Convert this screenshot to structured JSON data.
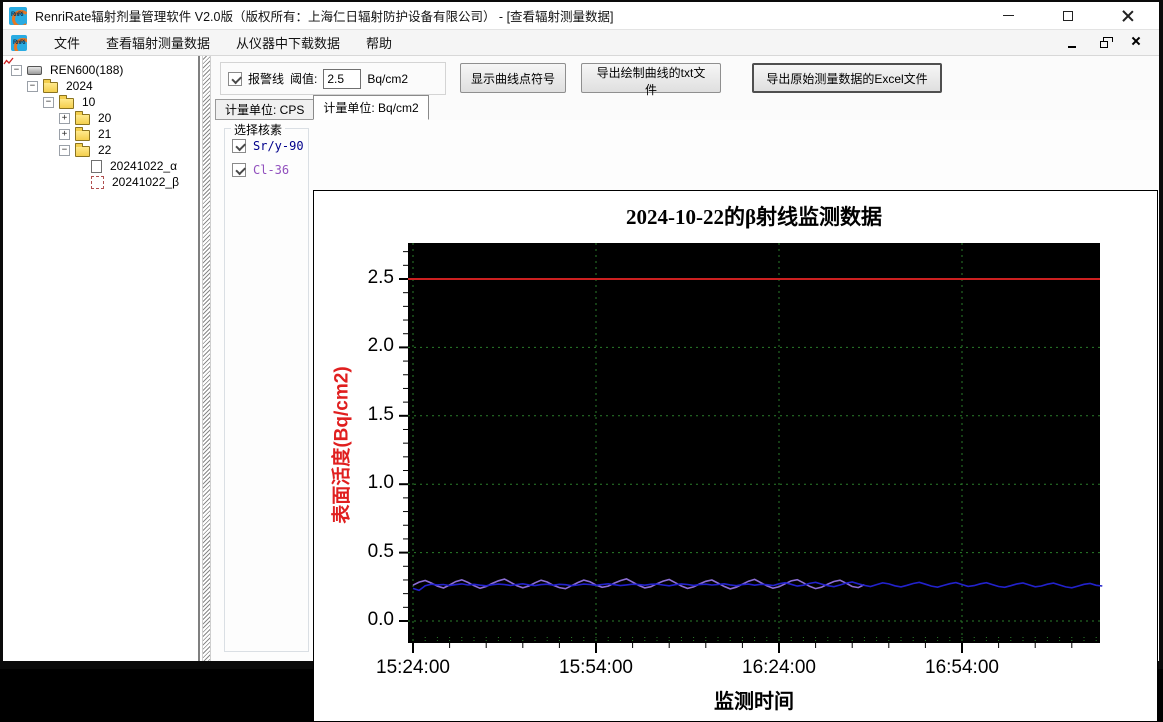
{
  "window": {
    "title": "RenriRate辐射剂量管理软件 V2.0版（版权所有：上海仁日辐射防护设备有限公司） - [查看辐射测量数据]"
  },
  "menu": {
    "items": [
      "文件",
      "查看辐射测量数据",
      "从仪器中下载数据",
      "帮助"
    ]
  },
  "tree": {
    "items": [
      {
        "label": "REN600(188)",
        "level": 0,
        "toggle": "minus",
        "icon": "device"
      },
      {
        "label": "2024",
        "level": 1,
        "toggle": "minus",
        "icon": "folder"
      },
      {
        "label": "10",
        "level": 2,
        "toggle": "minus",
        "icon": "folder"
      },
      {
        "label": "20",
        "level": 3,
        "toggle": "plus",
        "icon": "folder"
      },
      {
        "label": "21",
        "level": 3,
        "toggle": "plus",
        "icon": "folder"
      },
      {
        "label": "22",
        "level": 3,
        "toggle": "minus",
        "icon": "folder"
      },
      {
        "label": "20241022_α",
        "level": 4,
        "toggle": "none",
        "icon": "doc"
      },
      {
        "label": "20241022_β",
        "level": 4,
        "toggle": "none",
        "icon": "chart"
      }
    ]
  },
  "toolbar": {
    "alarm_label": "报警线",
    "threshold_label": "阈值:",
    "threshold_value": "2.5",
    "threshold_unit": "Bq/cm2",
    "buttons": [
      "显示曲线点符号",
      "导出绘制曲线的txt文件",
      "导出原始测量数据的Excel文件"
    ]
  },
  "tabs": [
    {
      "id": "cps",
      "label": "计量单位: CPS",
      "active": false
    },
    {
      "id": "bqcm2",
      "label": "计量单位: Bq/cm2",
      "active": true
    }
  ],
  "nuclide_panel": {
    "title": "选择核素",
    "items": [
      {
        "label": "Sr/y-90",
        "checked": true,
        "color": "#00008b"
      },
      {
        "label": "Cl-36",
        "checked": true,
        "color": "#9150be"
      }
    ]
  },
  "chart_data": {
    "type": "line",
    "title": "2024-10-22的β射线监测数据",
    "xlabel": "监测时间",
    "ylabel": "表面活度(Bq/cm2)",
    "ylabel_color": "#e01f1f",
    "plot_bg": "#000000",
    "grid_color": "#2a7d2a",
    "grid": true,
    "ylim": [
      0,
      2.5
    ],
    "yticks": [
      0.0,
      0.5,
      1.0,
      1.5,
      2.0,
      2.5
    ],
    "xticks": [
      {
        "label": "15:24:00",
        "minute": 0
      },
      {
        "label": "15:54:00",
        "minute": 30
      },
      {
        "label": "16:24:00",
        "minute": 60
      },
      {
        "label": "16:54:00",
        "minute": 90
      }
    ],
    "x_range_minutes": [
      0,
      112
    ],
    "alarm_line": {
      "value": 2.5,
      "color": "#cc2020"
    },
    "series": [
      {
        "name": "Cl-36",
        "color": "#8d6fd6",
        "start_minute": 0,
        "step_minutes": 1,
        "values": [
          0.262,
          0.284,
          0.296,
          0.278,
          0.255,
          0.241,
          0.263,
          0.288,
          0.301,
          0.282,
          0.258,
          0.239,
          0.252,
          0.275,
          0.294,
          0.306,
          0.283,
          0.259,
          0.243,
          0.256,
          0.279,
          0.298,
          0.285,
          0.261,
          0.244,
          0.236,
          0.258,
          0.281,
          0.299,
          0.287,
          0.263,
          0.246,
          0.255,
          0.277,
          0.295,
          0.308,
          0.284,
          0.26,
          0.242,
          0.251,
          0.273,
          0.292,
          0.303,
          0.28,
          0.256,
          0.238,
          0.249,
          0.271,
          0.29,
          0.3,
          0.277,
          0.253,
          0.235,
          0.247,
          0.269,
          0.291,
          0.304,
          0.281,
          0.257,
          0.24,
          0.25,
          0.272,
          0.293,
          0.302,
          0.279,
          0.254,
          0.237,
          0.248,
          0.27,
          0.289,
          0.298,
          0.276,
          0.252,
          0.244,
          0.266
        ]
      },
      {
        "name": "Sr/y-90",
        "color": "#2222cc",
        "start_minute": 0,
        "step_minutes": 1,
        "values": [
          0.238,
          0.224,
          0.258,
          0.269,
          0.264,
          0.267,
          0.259,
          0.266,
          0.271,
          0.263,
          0.268,
          0.262,
          0.257,
          0.265,
          0.27,
          0.266,
          0.26,
          0.267,
          0.272,
          0.264,
          0.259,
          0.266,
          0.269,
          0.262,
          0.268,
          0.265,
          0.258,
          0.263,
          0.27,
          0.267,
          0.261,
          0.266,
          0.272,
          0.265,
          0.259,
          0.264,
          0.269,
          0.266,
          0.262,
          0.268,
          0.27,
          0.263,
          0.257,
          0.265,
          0.271,
          0.267,
          0.26,
          0.266,
          0.269,
          0.263,
          0.267,
          0.272,
          0.264,
          0.258,
          0.266,
          0.27,
          0.262,
          0.268,
          0.265,
          0.259,
          0.272,
          0.28,
          0.268,
          0.255,
          0.262,
          0.275,
          0.283,
          0.27,
          0.258,
          0.251,
          0.263,
          0.277,
          0.285,
          0.272,
          0.26,
          0.252,
          0.266,
          0.279,
          0.271,
          0.257,
          0.249,
          0.261,
          0.274,
          0.283,
          0.269,
          0.255,
          0.247,
          0.26,
          0.273,
          0.281,
          0.267,
          0.253,
          0.259,
          0.272,
          0.28,
          0.266,
          0.252,
          0.246,
          0.258,
          0.271,
          0.278,
          0.264,
          0.25,
          0.256,
          0.269,
          0.277,
          0.263,
          0.249,
          0.243,
          0.255,
          0.268,
          0.274,
          0.261,
          0.256
        ]
      }
    ]
  }
}
